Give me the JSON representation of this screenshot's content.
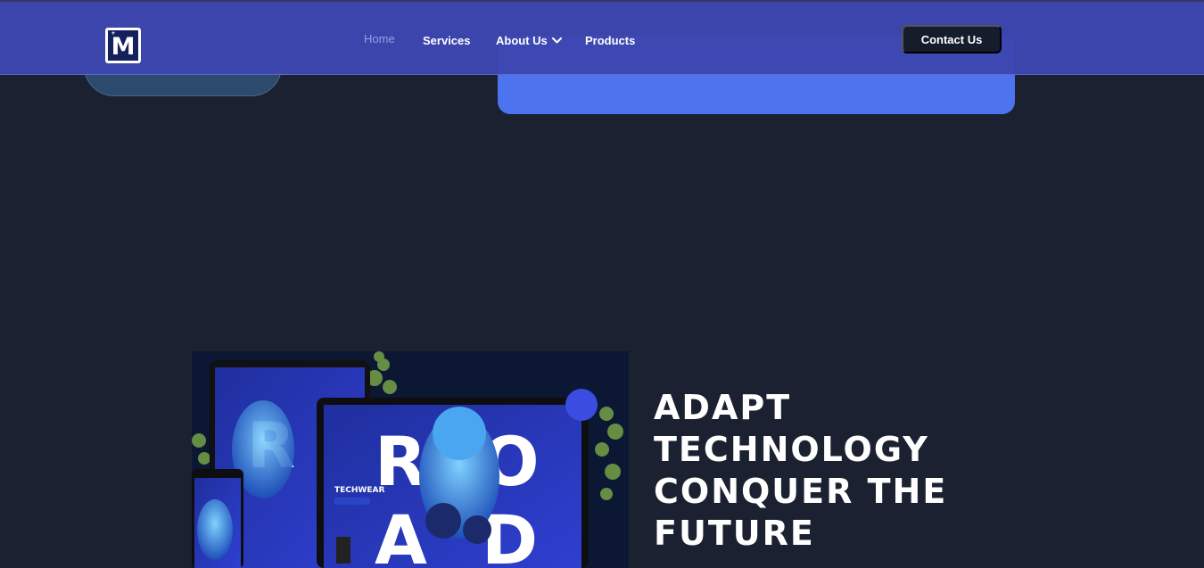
{
  "header": {
    "logo_letter": "M",
    "logo_star": "*",
    "nav": {
      "home": "Home",
      "services": "Services",
      "about": "About Us",
      "products": "Products"
    },
    "contact_label": "Contact Us"
  },
  "feature": {
    "image_text": {
      "brand": "TECHWEAR",
      "letters": [
        "R",
        "O",
        "A",
        "D"
      ]
    },
    "headline_lines": [
      "ADAPT",
      "TECHNOLOGY",
      "CONQUER THE",
      "FUTURE"
    ]
  },
  "colors": {
    "background": "#1b2130",
    "header": "#3e46af",
    "accent_card": "#4d73ef",
    "button": "#151c2c"
  }
}
